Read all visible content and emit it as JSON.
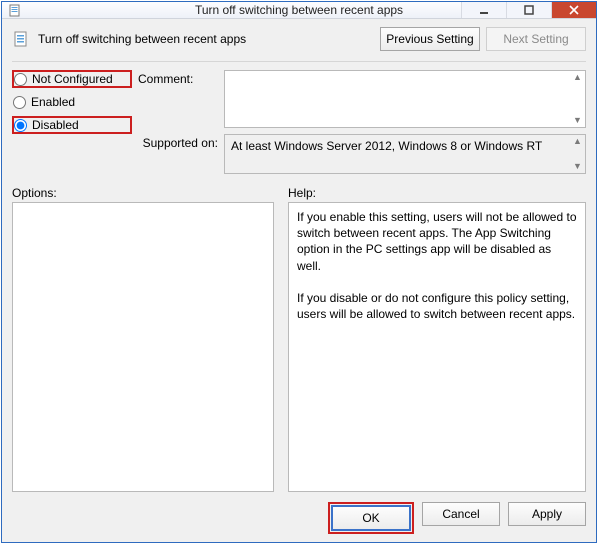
{
  "window": {
    "title": "Turn off switching between recent apps"
  },
  "header": {
    "title": "Turn off switching between recent apps",
    "prev_label": "Previous Setting",
    "next_label": "Next Setting"
  },
  "state": {
    "not_configured": "Not Configured",
    "enabled": "Enabled",
    "disabled": "Disabled",
    "selected": "disabled"
  },
  "labels": {
    "comment": "Comment:",
    "supported": "Supported on:",
    "options": "Options:",
    "help": "Help:"
  },
  "comment_value": "",
  "supported_value": "At least Windows Server 2012, Windows 8 or Windows RT",
  "help_text_p1": "If you enable this setting, users will not be allowed to switch between recent apps. The App Switching option in the PC settings app will be disabled as well.",
  "help_text_p2": "If you disable or do not configure this policy setting, users will be allowed to switch between recent apps.",
  "buttons": {
    "ok": "OK",
    "cancel": "Cancel",
    "apply": "Apply"
  }
}
